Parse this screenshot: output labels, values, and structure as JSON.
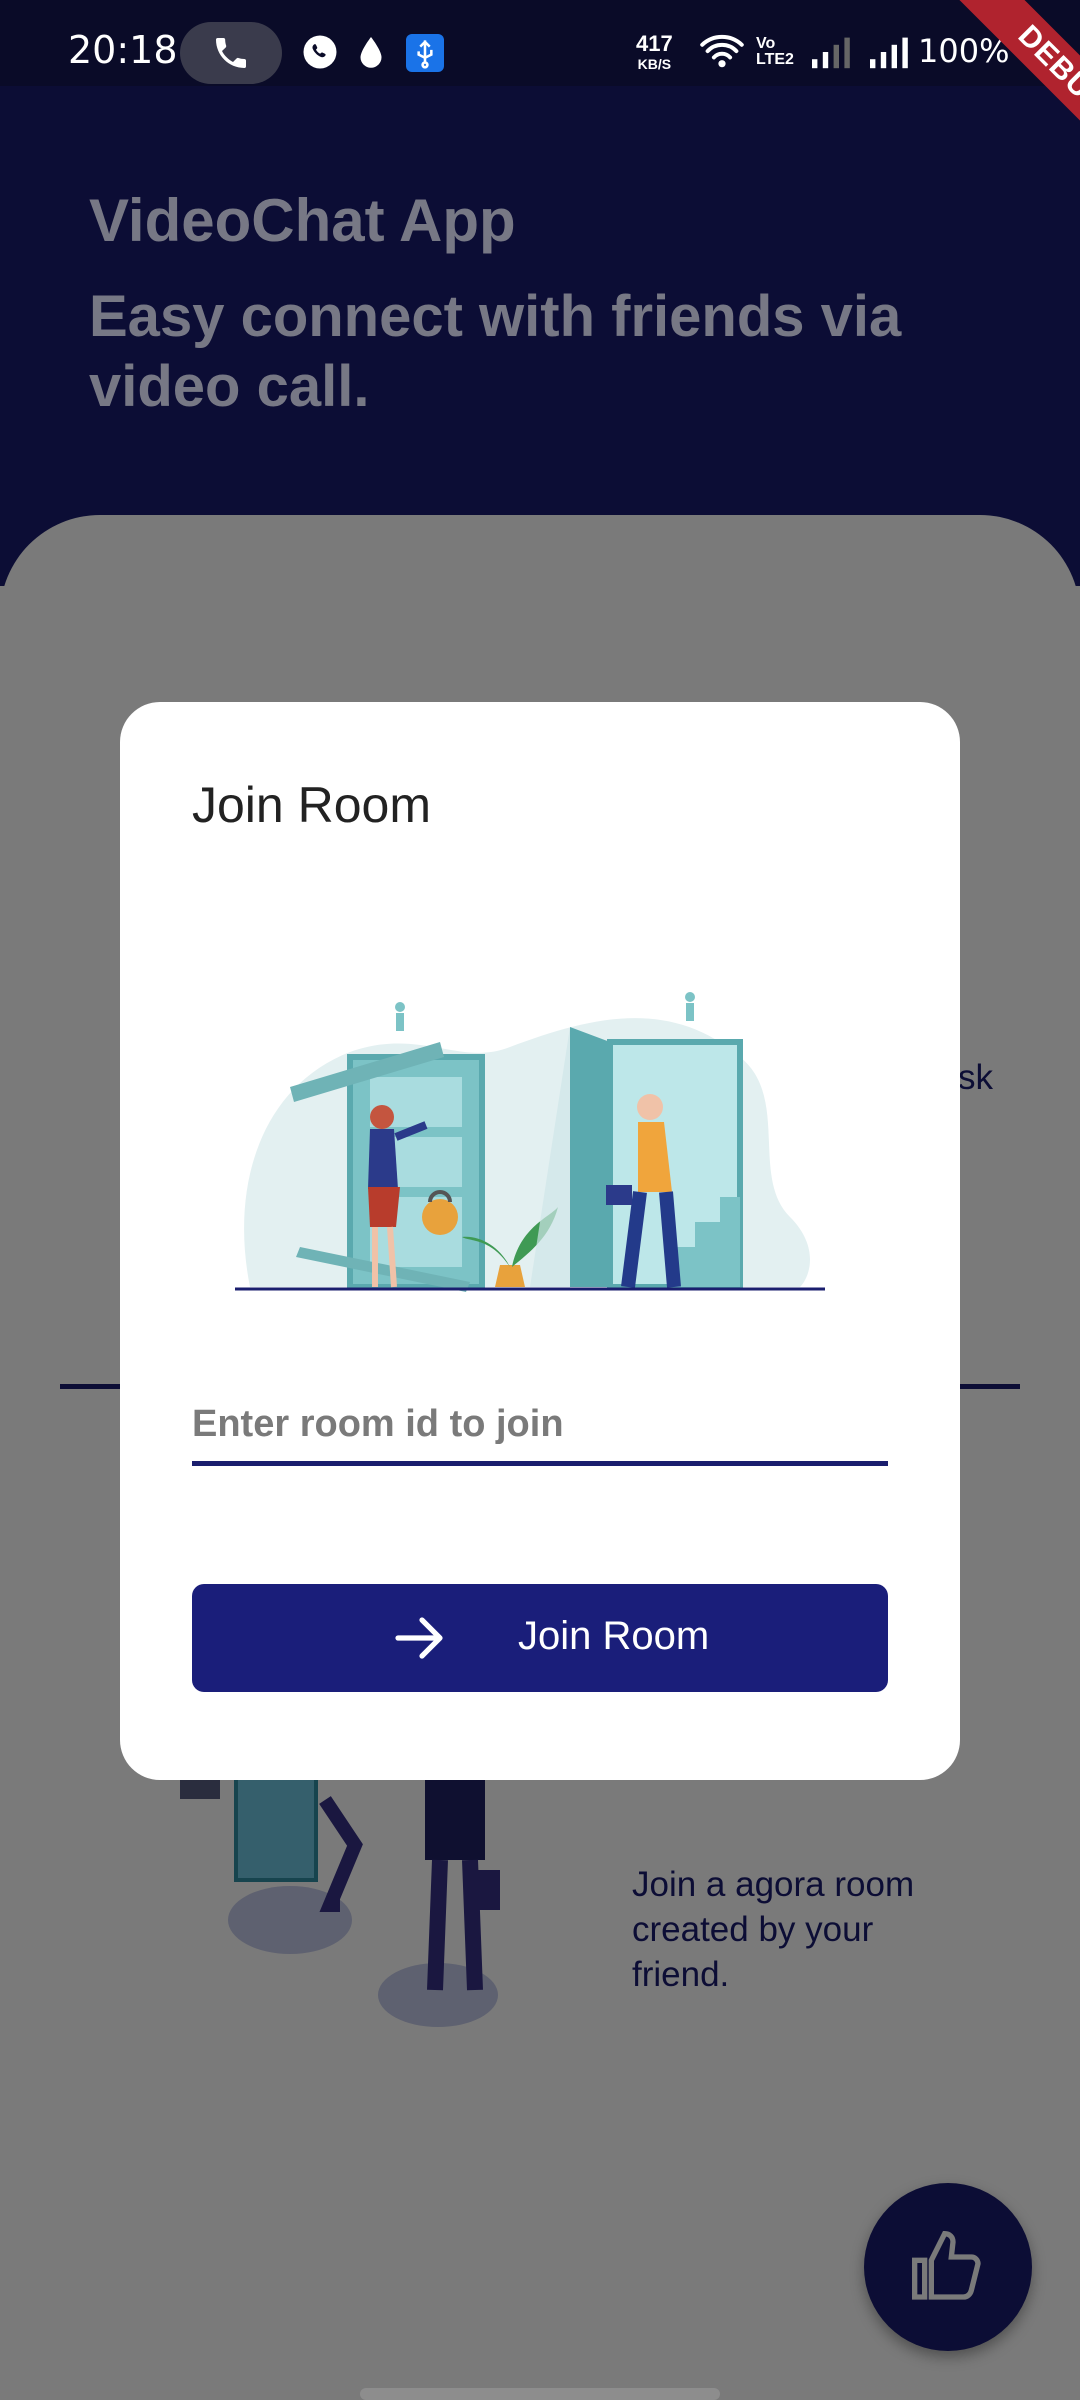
{
  "status_bar": {
    "time": "20:18",
    "net_speed_value": "417",
    "net_speed_unit": "KB/S",
    "volte_label": "Vo LTE2",
    "battery": "100%",
    "icons": [
      "phone-call-icon",
      "whatsapp-icon",
      "drop-icon",
      "usb-icon",
      "wifi-icon",
      "signal-icon",
      "signal-icon"
    ]
  },
  "debug_banner": "DEBUG",
  "header": {
    "app_title": "VideoChat App",
    "subtitle": "Easy connect with friends via video call."
  },
  "background": {
    "partial_text": "sk",
    "join_description": "Join a agora room created by your friend."
  },
  "dialog": {
    "title": "Join Room",
    "input_placeholder": "Enter room id to join",
    "input_value": "",
    "button_label": "Join Room",
    "button_icon": "arrow-right-icon"
  },
  "fab": {
    "icon": "thumb-up-icon"
  },
  "colors": {
    "primary": "#1a1e7a",
    "header_bg": "#0c0d35",
    "scrim_bg": "#7a7a7a",
    "debug_red": "#b0232e"
  }
}
